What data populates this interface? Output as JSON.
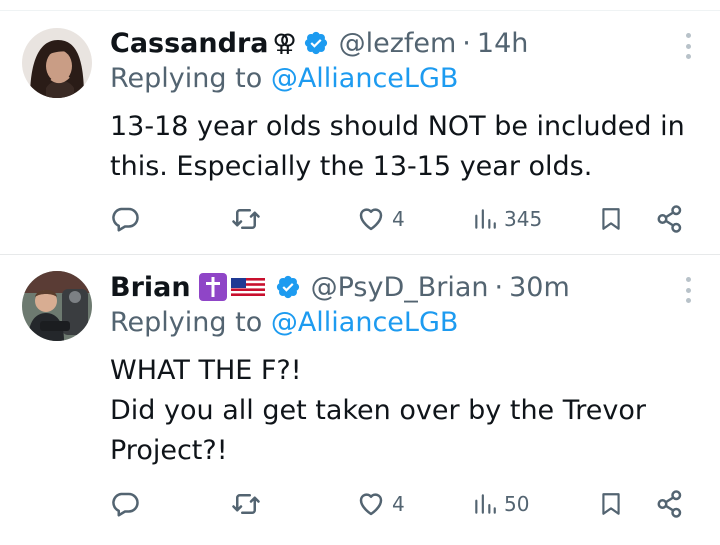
{
  "tweets": [
    {
      "name": "Cassandra",
      "name_emoji": "⚢",
      "verified_icon": "verified-badge-icon",
      "handle": "@lezfem",
      "separator": "·",
      "time": "14h",
      "replying_prefix": "Replying to",
      "replying_to": "@AllianceLGB",
      "body_lines": [
        "13-18 year olds should NOT be included in",
        "this. Especially the 13-15 year olds."
      ],
      "actions": {
        "reply": "",
        "retweet": "",
        "likes": "4",
        "views": "345"
      }
    },
    {
      "name": "Brian",
      "name_emoji": "✝️🇺🇸",
      "verified_icon": "verified-badge-icon",
      "handle": "@PsyD_Brian",
      "separator": "·",
      "time": "30m",
      "replying_prefix": "Replying to",
      "replying_to": "@AllianceLGB",
      "body_lines": [
        "WHAT THE F?!",
        "Did you all get taken over by the Trevor",
        "Project?!"
      ],
      "actions": {
        "reply": "",
        "retweet": "",
        "likes": "4",
        "views": "50"
      }
    }
  ],
  "colors": {
    "text": "#0f1419",
    "secondary": "#536471",
    "link": "#1d9bf0",
    "divider": "#e7e9ea",
    "cross_badge": "#8f45c7"
  }
}
